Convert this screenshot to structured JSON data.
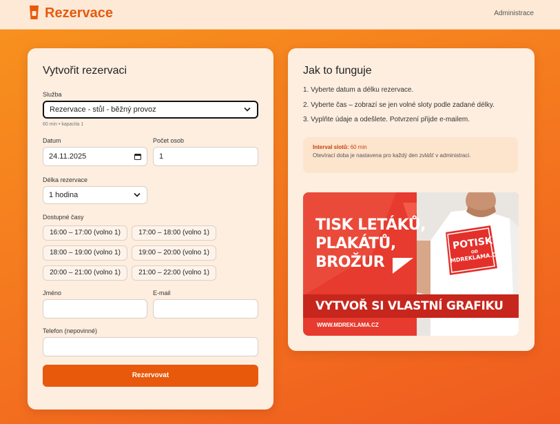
{
  "header": {
    "brand": "Rezervace",
    "admin_link": "Administrace"
  },
  "form": {
    "title": "Vytvořit rezervaci",
    "service_label": "Služba",
    "service_value": "Rezervace - stůl - běžný provoz",
    "service_hint": "60 min • kapacita 1",
    "date_label": "Datum",
    "date_value": "24.11.2025",
    "persons_label": "Počet osob",
    "persons_value": "1",
    "duration_label": "Délka rezervace",
    "duration_value": "1 hodina",
    "slots_label": "Dostupné časy",
    "slots": [
      "16:00 – 17:00 (volno 1)",
      "17:00 – 18:00 (volno 1)",
      "18:00 – 19:00 (volno 1)",
      "19:00 – 20:00 (volno 1)",
      "20:00 – 21:00 (volno 1)",
      "21:00 – 22:00 (volno 1)"
    ],
    "name_label": "Jméno",
    "email_label": "E-mail",
    "phone_label": "Telefon (nepovinné)",
    "submit_label": "Rezervovat"
  },
  "howto": {
    "title": "Jak to funguje",
    "steps": [
      "1. Vyberte datum a délku rezervace.",
      "2. Vyberte čas – zobrazí se jen volné sloty podle zadané délky.",
      "3. Vyplňte údaje a odešlete. Potvrzení přijde e-mailem."
    ],
    "interval_label": "Interval slotů:",
    "interval_value": "60 min",
    "interval_note": "Otevírací doba je nastavena pro každý den zvlášť v administraci."
  },
  "banner": {
    "headline_1": "TISK LETÁKŮ,",
    "headline_2": "PLAKÁTŮ,",
    "headline_3": "BROŽUR",
    "badge_1": "POTISK",
    "badge_2": "OD",
    "badge_3": "MDREKLAMA.CZ",
    "cta": "VYTVOŘ SI VLASTNÍ GRAFIKU",
    "url": "WWW.MDREKLAMA.CZ"
  },
  "colors": {
    "accent": "#e8590c",
    "card": "#fdeee0",
    "banner_red": "#e63b2e"
  }
}
